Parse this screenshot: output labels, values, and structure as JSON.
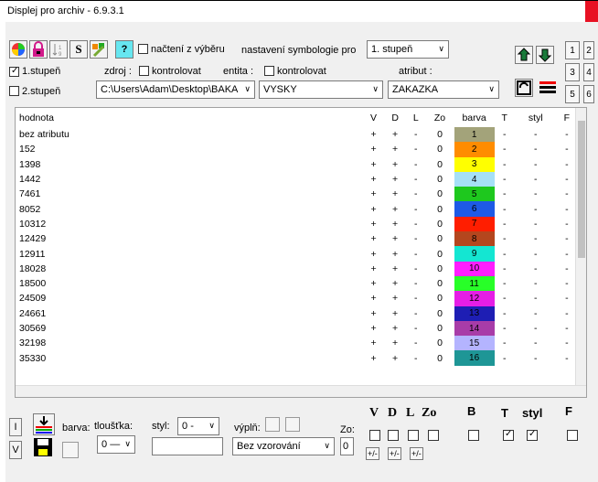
{
  "window": {
    "title": "Displej pro archiv - 6.9.3.1"
  },
  "toolbar": {
    "help_label": "?",
    "s_label": "S",
    "nacteni_label": "načtení z výběru",
    "nastaveni_label": "nastavení symbologie pro",
    "nastaveni_value": "1. stupeň",
    "stupen1_label": "1.stupeň",
    "stupen2_label": "2.stupeň",
    "zdroj_label": "zdroj :",
    "kontrolovat_label": "kontrolovat",
    "entita_label": "entita :",
    "atribut_label": "atribut :",
    "path_value": "C:\\Users\\Adam\\Desktop\\BAKA",
    "entita_value": "VYSKY",
    "atribut_value": "ZAKAZKA",
    "num_buttons": [
      "1",
      "2",
      "3",
      "4",
      "5",
      "6"
    ]
  },
  "table": {
    "headers": [
      "hodnota",
      "V",
      "D",
      "L",
      "Zo",
      "barva",
      "T",
      "styl",
      "F"
    ],
    "rows": [
      {
        "hodnota": "bez atributu",
        "v": "+",
        "d": "+",
        "l": "-",
        "zo": "0",
        "barva": "1",
        "color": "#a3a37a",
        "t": "-",
        "styl": "-",
        "f": "-"
      },
      {
        "hodnota": "152",
        "v": "+",
        "d": "+",
        "l": "-",
        "zo": "0",
        "barva": "2",
        "color": "#ff8c00",
        "t": "-",
        "styl": "-",
        "f": "-"
      },
      {
        "hodnota": "1398",
        "v": "+",
        "d": "+",
        "l": "-",
        "zo": "0",
        "barva": "3",
        "color": "#ffff00",
        "t": "-",
        "styl": "-",
        "f": "-"
      },
      {
        "hodnota": "1442",
        "v": "+",
        "d": "+",
        "l": "-",
        "zo": "0",
        "barva": "4",
        "color": "#a6e0f7",
        "t": "-",
        "styl": "-",
        "f": "-"
      },
      {
        "hodnota": "7461",
        "v": "+",
        "d": "+",
        "l": "-",
        "zo": "0",
        "barva": "5",
        "color": "#1ec81e",
        "t": "-",
        "styl": "-",
        "f": "-"
      },
      {
        "hodnota": "8052",
        "v": "+",
        "d": "+",
        "l": "-",
        "zo": "0",
        "barva": "6",
        "color": "#1e5ae6",
        "t": "-",
        "styl": "-",
        "f": "-"
      },
      {
        "hodnota": "10312",
        "v": "+",
        "d": "+",
        "l": "-",
        "zo": "0",
        "barva": "7",
        "color": "#ff1e00",
        "t": "-",
        "styl": "-",
        "f": "-"
      },
      {
        "hodnota": "12429",
        "v": "+",
        "d": "+",
        "l": "-",
        "zo": "0",
        "barva": "8",
        "color": "#b4461e",
        "t": "-",
        "styl": "-",
        "f": "-"
      },
      {
        "hodnota": "12911",
        "v": "+",
        "d": "+",
        "l": "-",
        "zo": "0",
        "barva": "9",
        "color": "#14e6d2",
        "t": "-",
        "styl": "-",
        "f": "-"
      },
      {
        "hodnota": "18028",
        "v": "+",
        "d": "+",
        "l": "-",
        "zo": "0",
        "barva": "10",
        "color": "#ff1eff",
        "t": "-",
        "styl": "-",
        "f": "-"
      },
      {
        "hodnota": "18500",
        "v": "+",
        "d": "+",
        "l": "-",
        "zo": "0",
        "barva": "11",
        "color": "#28ff28",
        "t": "-",
        "styl": "-",
        "f": "-"
      },
      {
        "hodnota": "24509",
        "v": "+",
        "d": "+",
        "l": "-",
        "zo": "0",
        "barva": "12",
        "color": "#e61ee6",
        "t": "-",
        "styl": "-",
        "f": "-"
      },
      {
        "hodnota": "24661",
        "v": "+",
        "d": "+",
        "l": "-",
        "zo": "0",
        "barva": "13",
        "color": "#1e1eb4",
        "t": "-",
        "styl": "-",
        "f": "-"
      },
      {
        "hodnota": "30569",
        "v": "+",
        "d": "+",
        "l": "-",
        "zo": "0",
        "barva": "14",
        "color": "#a83ca8",
        "t": "-",
        "styl": "-",
        "f": "-"
      },
      {
        "hodnota": "32198",
        "v": "+",
        "d": "+",
        "l": "-",
        "zo": "0",
        "barva": "15",
        "color": "#b4b4ff",
        "t": "-",
        "styl": "-",
        "f": "-"
      },
      {
        "hodnota": "35330",
        "v": "+",
        "d": "+",
        "l": "-",
        "zo": "0",
        "barva": "16",
        "color": "#1e9696",
        "t": "-",
        "styl": "-",
        "f": "-"
      }
    ]
  },
  "bottom": {
    "i_label": "I",
    "v_label": "V",
    "barva_label": "barva:",
    "tloustka_label": "tloušťka:",
    "tloustka_value": "0",
    "styl_label": "styl:",
    "styl_value": "0",
    "vypln_label": "výplň:",
    "zo_label": "Zo:",
    "zo_value": "0",
    "vzor_value": "Bez vzorování",
    "col_labels": [
      "V",
      "D",
      "L",
      "Zo",
      "B",
      "T",
      "styl",
      "F"
    ],
    "pm_label": "+/-"
  }
}
